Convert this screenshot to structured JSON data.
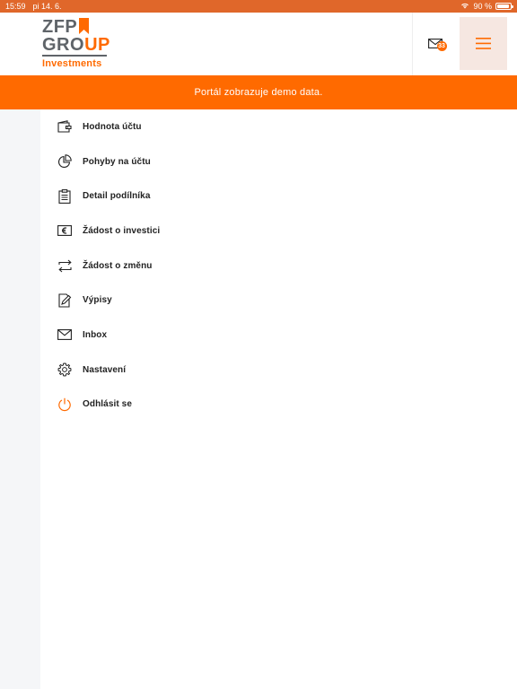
{
  "status_bar": {
    "time": "15:59",
    "date": "pi 14. 6.",
    "battery": "90 %",
    "battery_level": 0.9
  },
  "header": {
    "logo": {
      "line1": "ZFP",
      "line2a": "GRO",
      "line2b": "UP",
      "line3": "Investments"
    },
    "inbox_badge": "33",
    "accent_color": "#ff6a00"
  },
  "banner": {
    "text": "Portál zobrazuje demo data."
  },
  "menu": {
    "items": [
      {
        "label": "Hodnota účtu",
        "icon": "wallet-icon"
      },
      {
        "label": "Pohyby na účtu",
        "icon": "pie-chart-icon"
      },
      {
        "label": "Detail podílníka",
        "icon": "clipboard-icon"
      },
      {
        "label": "Žádost o investici",
        "icon": "euro-card-icon"
      },
      {
        "label": "Žádost o změnu",
        "icon": "exchange-arrows-icon"
      },
      {
        "label": "Výpisy",
        "icon": "document-edit-icon"
      },
      {
        "label": "Inbox",
        "icon": "envelope-icon"
      },
      {
        "label": "Nastavení",
        "icon": "gear-icon"
      },
      {
        "label": "Odhlásit se",
        "icon": "power-icon",
        "color": "#ff6a00"
      }
    ]
  }
}
